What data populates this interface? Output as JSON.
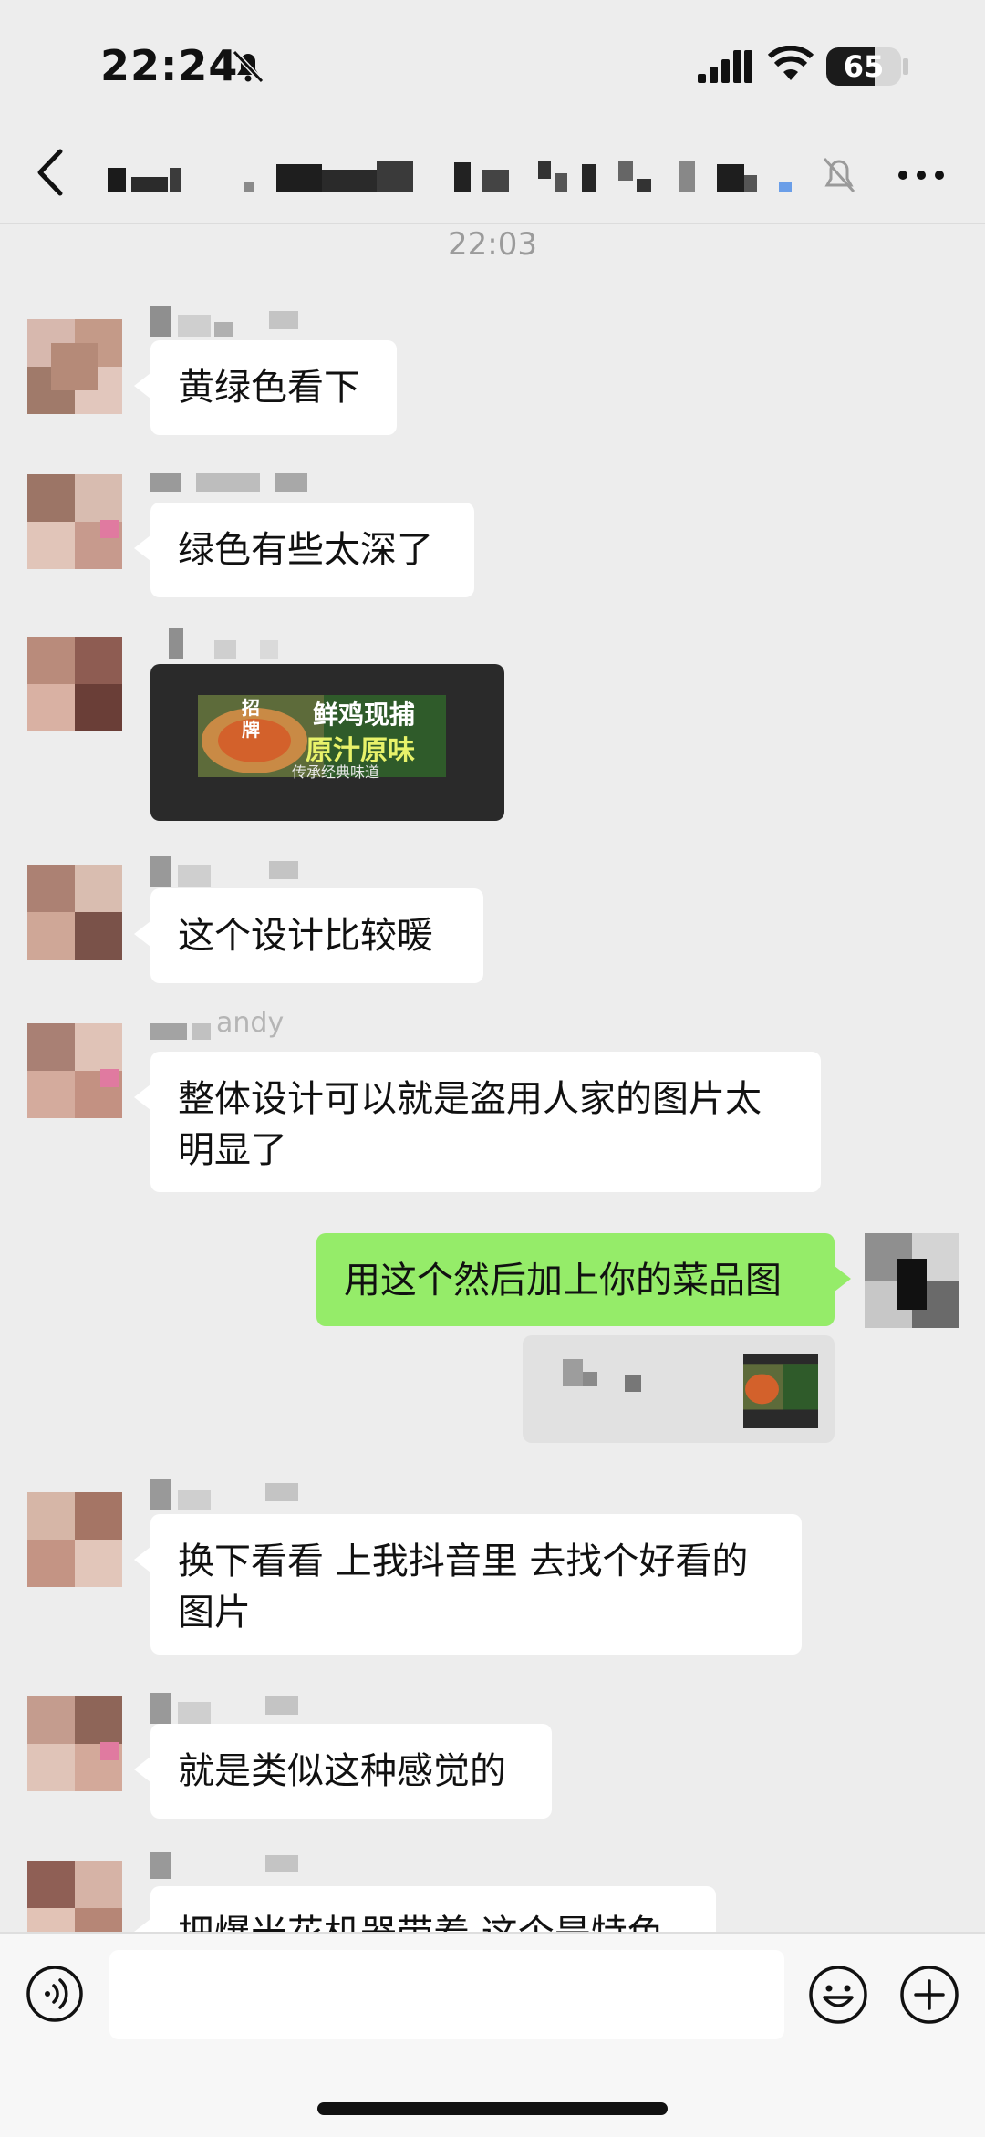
{
  "status_bar": {
    "time": "22:24",
    "battery": "65",
    "battery_level": 0.65
  },
  "timestamp": "22:03",
  "messages": [
    {
      "text": "黄绿色看下"
    },
    {
      "text": "绿色有些太深了"
    },
    {
      "image_texts": {
        "badge": "招牌",
        "title": "鲜鸡现捕",
        "headline": "原汁原味",
        "footer": "传承经典味道"
      }
    },
    {
      "text": "这个设计比较暖"
    },
    {
      "sender_fragment": "andy",
      "text": "整体设计可以就是盗用人家的图片太\n明显了"
    },
    {
      "text": "用这个然后加上你的菜品图"
    },
    {
      "text": "换下看看 上我抖音里 去找个好看的\n图片"
    },
    {
      "text": "就是类似这种感觉的"
    },
    {
      "text": "把爆米花机器带着 这个是特色"
    }
  ],
  "colors": {
    "background": "#ededed",
    "outgoing_bubble": "#95ec69",
    "incoming_bubble": "#ffffff"
  }
}
